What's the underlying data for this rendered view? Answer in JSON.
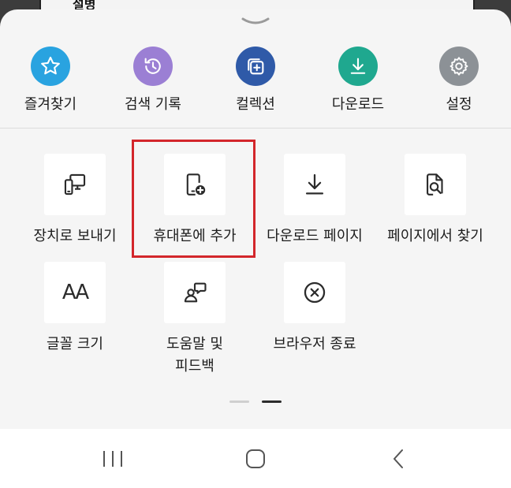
{
  "background": {
    "peek_text": "설병"
  },
  "quick_actions": [
    {
      "label": "즐겨찾기",
      "icon": "star-icon",
      "color": "#29a3e0"
    },
    {
      "label": "검색 기록",
      "icon": "history-icon",
      "color": "#9b7fd4"
    },
    {
      "label": "컬렉션",
      "icon": "collections-icon",
      "color": "#2f5aa8"
    },
    {
      "label": "다운로드",
      "icon": "download-icon",
      "color": "#1fa88f"
    },
    {
      "label": "설정",
      "icon": "gear-icon",
      "color": "#8c9196"
    }
  ],
  "grid_items": [
    {
      "label": "장치로 보내기",
      "icon": "send-to-device-icon"
    },
    {
      "label": "휴대폰에 추가",
      "icon": "add-to-phone-icon"
    },
    {
      "label": "다운로드 페이지",
      "icon": "download-page-icon"
    },
    {
      "label": "페이지에서 찾기",
      "icon": "find-in-page-icon"
    },
    {
      "label": "글꼴 크기",
      "icon": "font-size-icon",
      "glyph": "AA"
    },
    {
      "label": "도움말 및\n피드백",
      "line1": "도움말 및",
      "line2": "피드백",
      "icon": "help-feedback-icon"
    },
    {
      "label": "브라우저 종료",
      "icon": "close-browser-icon"
    }
  ],
  "colors": {
    "highlight": "#d3262b",
    "sheet": "#f5f5f5",
    "accent_icon": "#2b2b2b"
  },
  "pagination": {
    "pages": 2,
    "current": 2
  },
  "navbar": {
    "recents": "recents-icon",
    "home": "home-icon",
    "back": "back-icon"
  }
}
